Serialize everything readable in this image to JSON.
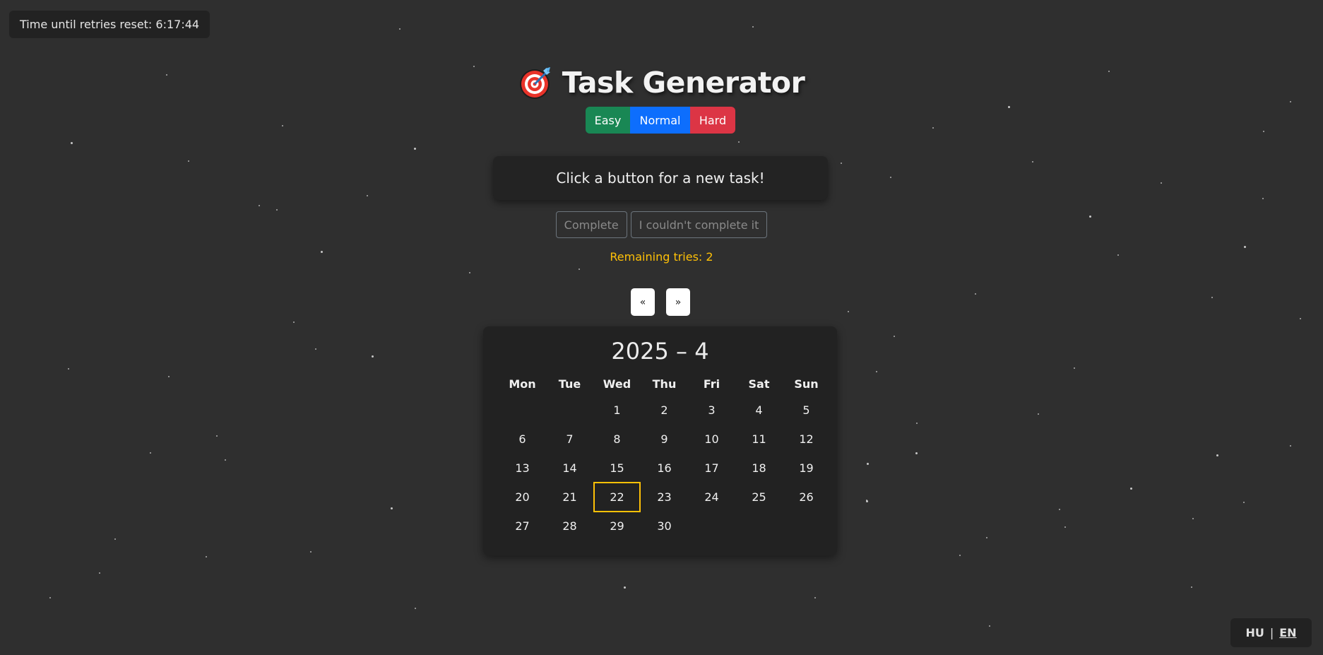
{
  "timer": {
    "text": "Time until retries reset: 6:17:44"
  },
  "header": {
    "title": "Task Generator",
    "icon": "target-dart-icon"
  },
  "difficulty": {
    "easy": "Easy",
    "normal": "Normal",
    "hard": "Hard"
  },
  "task": {
    "text": "Click a button for a new task!"
  },
  "actions": {
    "complete": "Complete",
    "fail": "I couldn't complete it"
  },
  "tries": {
    "text": "Remaining tries: 2"
  },
  "nav": {
    "prev": "«",
    "next": "»"
  },
  "calendar": {
    "title": "2025 – 4",
    "weekdays": [
      "Mon",
      "Tue",
      "Wed",
      "Thu",
      "Fri",
      "Sat",
      "Sun"
    ],
    "leading_blanks": 2,
    "days": [
      "1",
      "2",
      "3",
      "4",
      "5",
      "6",
      "7",
      "8",
      "9",
      "10",
      "11",
      "12",
      "13",
      "14",
      "15",
      "16",
      "17",
      "18",
      "19",
      "20",
      "21",
      "22",
      "23",
      "24",
      "25",
      "26",
      "27",
      "28",
      "29",
      "30"
    ],
    "today": "22",
    "today_color": "#ffc107"
  },
  "lang": {
    "hu": "HU",
    "separator": "|",
    "en": "EN",
    "active": "EN"
  },
  "colors": {
    "background": "#2f2f2f",
    "easy": "#198754",
    "normal": "#0d6efd",
    "hard": "#dc3545",
    "warning": "#ffc107"
  }
}
